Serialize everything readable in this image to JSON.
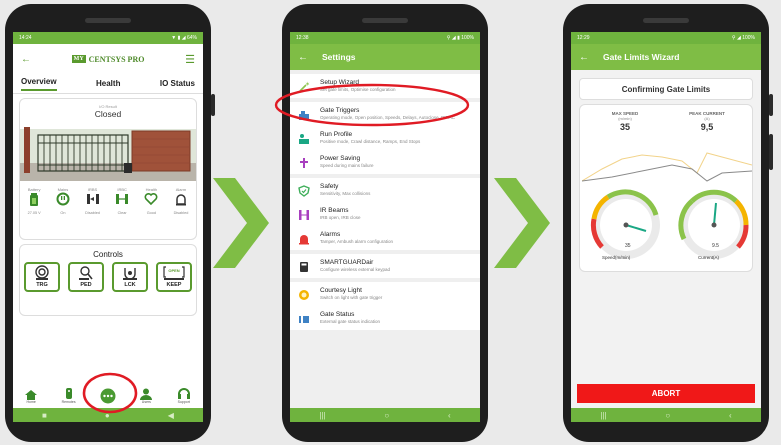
{
  "phone1": {
    "time": "14:24",
    "status_icons": "▼ ▮ ◢ 64%",
    "brand_box": "MY",
    "brand_text": "CENTSYS PRO",
    "tabs": [
      "Overview",
      "Health",
      "IO Status"
    ],
    "status_caption": "I/O Result",
    "gate_state": "Closed",
    "indicators": [
      {
        "label": "Battery",
        "value": "27.05 V"
      },
      {
        "label": "Mains",
        "value": "On"
      },
      {
        "label": "IRBS",
        "value": "Disabled"
      },
      {
        "label": "IRBC",
        "value": "Clear"
      },
      {
        "label": "Health",
        "value": "Good"
      },
      {
        "label": "Alarm",
        "value": "Disabled"
      }
    ],
    "controls_title": "Controls",
    "controls": [
      {
        "label": "TRG",
        "icon": "trigger-icon"
      },
      {
        "label": "PED",
        "icon": "pedestrian-icon"
      },
      {
        "label": "LCK",
        "icon": "lock-icon"
      },
      {
        "label": "KEEP",
        "icon": "keep-open-icon",
        "badge": "OPEN"
      }
    ],
    "bottom_nav": [
      "Home",
      "Remotes",
      "",
      "Users",
      "Support"
    ]
  },
  "phone2": {
    "time": "12:38",
    "status_icons": "⚲ ◢ ▮ 100%",
    "title": "Settings",
    "groups": [
      [
        {
          "title": "Setup Wizard",
          "desc": "Set gate limits, Optimise configuration",
          "icon": "wand-icon",
          "color": "#8bc34a"
        }
      ],
      [
        {
          "title": "Gate Triggers",
          "desc": "Operating mode, Open position, Speeds, Delays, Autoclose, PIRAC",
          "icon": "gate-triggers-icon",
          "color": "#3f82c4"
        },
        {
          "title": "Run Profile",
          "desc": "Positive mode, Crawl distance, Ramps, End Stops",
          "icon": "run-profile-icon",
          "color": "#1aa784"
        },
        {
          "title": "Power Saving",
          "desc": "Speed during mains failure",
          "icon": "power-saving-icon",
          "color": "#a83fbf"
        }
      ],
      [
        {
          "title": "Safety",
          "desc": "Sensitivity, Max collisions",
          "icon": "safety-shield-icon",
          "color": "#3fae5a"
        },
        {
          "title": "IR Beams",
          "desc": "IRB open, IRB close",
          "icon": "ir-beams-icon",
          "color": "#a83fbf"
        },
        {
          "title": "Alarms",
          "desc": "Tamper, Ambush alarm configuration",
          "icon": "alarm-icon",
          "color": "#e53935"
        }
      ],
      [
        {
          "title": "SMARTGUARDair",
          "desc": "Configure wireless external keypad",
          "icon": "keypad-icon",
          "color": "#333333"
        }
      ],
      [
        {
          "title": "Courtesy Light",
          "desc": "Switch on light with gate trigger",
          "icon": "courtesy-light-icon",
          "color": "#f4b400"
        },
        {
          "title": "Gate Status",
          "desc": "External gate status indication",
          "icon": "gate-status-icon",
          "color": "#3f82c4"
        }
      ]
    ]
  },
  "phone3": {
    "time": "12:29",
    "status_icons": "⚲ ◢ 100%",
    "title": "Gate Limits Wizard",
    "header": "Confirming Gate Limits",
    "max_speed": {
      "label": "MAX SPEED",
      "unit": "(m/min)",
      "value": "35"
    },
    "peak_current": {
      "label": "PEAK CURRENT",
      "unit": "(A)",
      "value": "9,5"
    },
    "speed_gauge": {
      "label": "Speed(m/min)",
      "value": "35",
      "fraction": 0.65
    },
    "current_gauge": {
      "label": "Current(A)",
      "value": "9.5",
      "fraction": 0.5
    },
    "abort_label": "ABORT"
  },
  "colors": {
    "brand_green": "#7fbd45",
    "abort_red": "#f01818",
    "highlight_red": "#e01b24"
  }
}
